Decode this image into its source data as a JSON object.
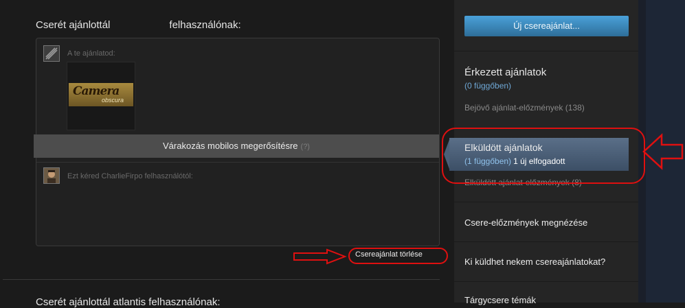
{
  "left": {
    "offer1": {
      "title_prefix": "Cserét ajánlottál",
      "title_suffix": "felhasználónak:",
      "your_offer_label": "A te ajánlatod:",
      "item": {
        "line1": "Camera",
        "line2": "obscura"
      },
      "status": "Várakozás mobilos megerősítésre",
      "status_help": "(?)",
      "request_label": "Ezt kéred CharlieFirpo felhasználótól:",
      "cancel_label": "Csereajánlat törlése"
    },
    "offer2": {
      "title": "Cserét ajánlottál atlantis felhasználónak:"
    }
  },
  "sidebar": {
    "new_offer": "Új csereajánlat...",
    "incoming": {
      "title": "Érkezett ajánlatok",
      "pending": "(0 függőben)",
      "history": "Bejövő ajánlat-előzmények (138)"
    },
    "sent": {
      "title": "Elküldött ajánlatok",
      "pending": "(1 függőben)",
      "accepted": "1 új elfogadott",
      "history": "Elküldött ajánlat-előzmények (8)"
    },
    "trade_history": "Csere-előzmények megnézése",
    "who_can_send": "Ki küldhet nekem csereajánlatokat?",
    "trade_topics": "Tárgycsere témák"
  },
  "colors": {
    "accent_blue": "#4aa1d9",
    "annotation_red": "#e01010",
    "pending_blue": "#6fa8d6"
  }
}
